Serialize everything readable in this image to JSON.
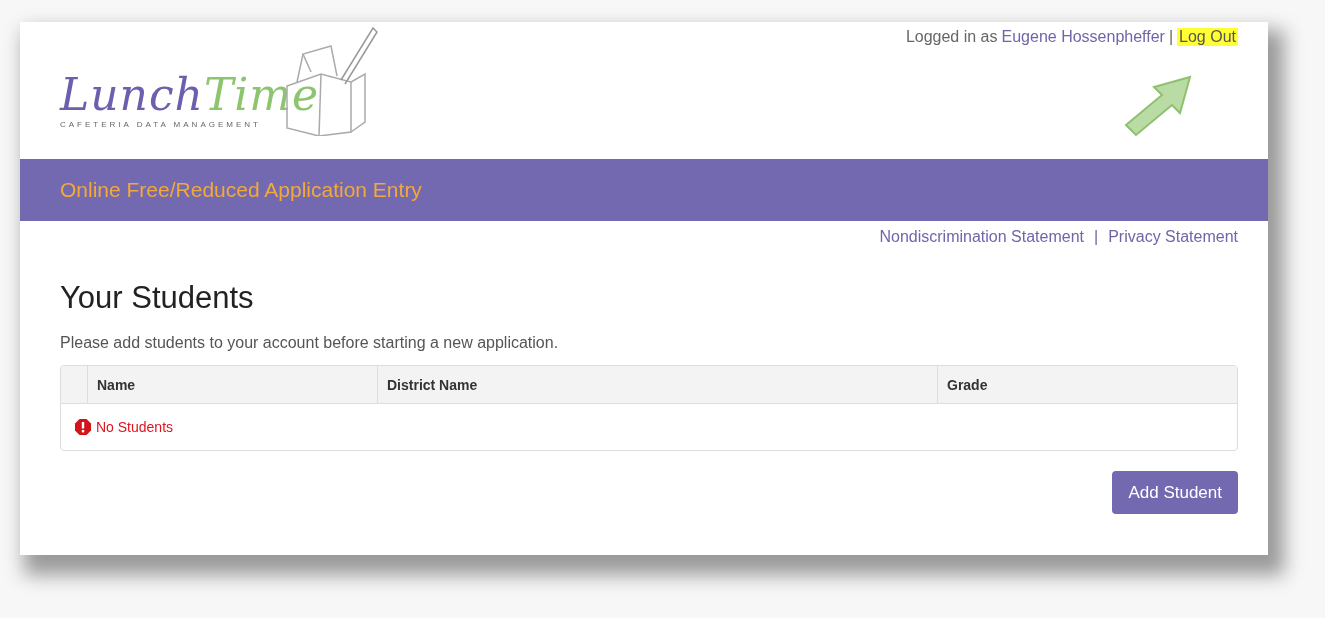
{
  "logo": {
    "parts": [
      {
        "text": "Lunch",
        "color": "#6b5fae"
      },
      {
        "text": "Time",
        "color": "#8cc56e"
      }
    ],
    "tagline": "CAFETERIA DATA MANAGEMENT"
  },
  "user_bar": {
    "prefix": "Logged in as",
    "user": "Eugene Hossenpheffer",
    "separator": "|",
    "logout": {
      "label": "Log Out",
      "highlighted": true
    }
  },
  "annotation": {
    "kind": "arrow"
  },
  "banner": {
    "title": "Online Free/Reduced Application Entry"
  },
  "footer_links": [
    {
      "label": "Nondiscrimination Statement"
    },
    {
      "label": "Privacy Statement"
    }
  ],
  "footer_separator": "|",
  "heading": "Your Students",
  "intro": "Please add students to your account before starting a new application.",
  "table": {
    "columns": [
      "Name",
      "District Name",
      "Grade"
    ],
    "empty_message": "No Students"
  },
  "buttons": [
    {
      "label": "Add Student"
    }
  ]
}
